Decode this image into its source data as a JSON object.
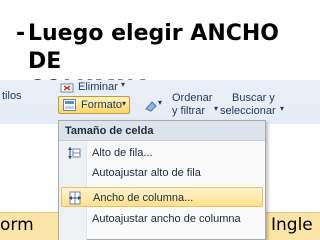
{
  "slide": {
    "bullet": "-",
    "heading": "Luego elegir ANCHO DE\nCOLUMNA"
  },
  "ribbon": {
    "partial_left": "tilos",
    "eliminar": "Eliminar",
    "formato": "Formato",
    "ordenar_line1": "Ordenar",
    "ordenar_line2": "y filtrar",
    "buscar_line1": "Buscar y",
    "buscar_line2": "seleccionar"
  },
  "menu": {
    "header": "Tamaño de celda",
    "items": [
      {
        "label": "Alto de fila...",
        "icon": "row-height-icon",
        "highlighted": false
      },
      {
        "label": "Autoajustar alto de fila",
        "icon": "",
        "highlighted": false
      },
      {
        "label": "Ancho de columna...",
        "icon": "column-width-icon",
        "highlighted": true
      },
      {
        "label": "Autoajustar ancho de columna",
        "icon": "",
        "highlighted": false
      }
    ]
  },
  "sheet": {
    "left_text": "orm",
    "right_text": "Ingle"
  },
  "colors": {
    "menu_hover": "#ffe08a",
    "ribbon_bg": "#dbe5f1",
    "sheet_highlight": "#fbe4a7"
  }
}
